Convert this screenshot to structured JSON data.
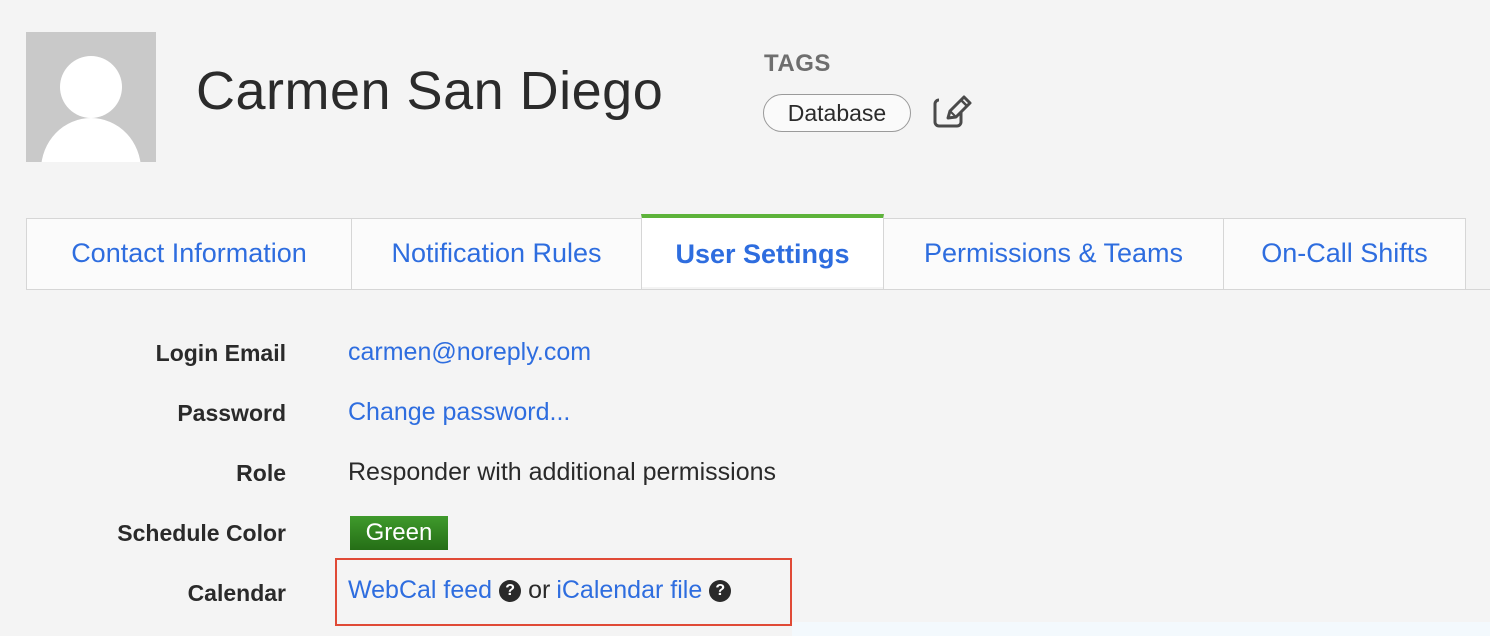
{
  "user": {
    "name": "Carmen San Diego"
  },
  "tags": {
    "label": "TAGS",
    "items": [
      "Database"
    ]
  },
  "tabs": [
    {
      "label": "Contact Information",
      "active": false
    },
    {
      "label": "Notification Rules",
      "active": false
    },
    {
      "label": "User Settings",
      "active": true
    },
    {
      "label": "Permissions & Teams",
      "active": false
    },
    {
      "label": "On-Call Shifts",
      "active": false
    }
  ],
  "settings": {
    "login_email": {
      "label": "Login Email",
      "value": "carmen@noreply.com"
    },
    "password": {
      "label": "Password",
      "value": "Change password..."
    },
    "role": {
      "label": "Role",
      "value": "Responder with additional permissions"
    },
    "schedule_color": {
      "label": "Schedule Color",
      "value": "Green"
    },
    "calendar": {
      "label": "Calendar",
      "webcal": "WebCal feed",
      "separator": "or",
      "ical": "iCalendar file"
    }
  },
  "icons": {
    "help": "?"
  },
  "colors": {
    "accent_link": "#2e6ddf",
    "active_tab_border": "#5db33a",
    "schedule_green": "#2f8420",
    "highlight_box": "#e04a36"
  }
}
